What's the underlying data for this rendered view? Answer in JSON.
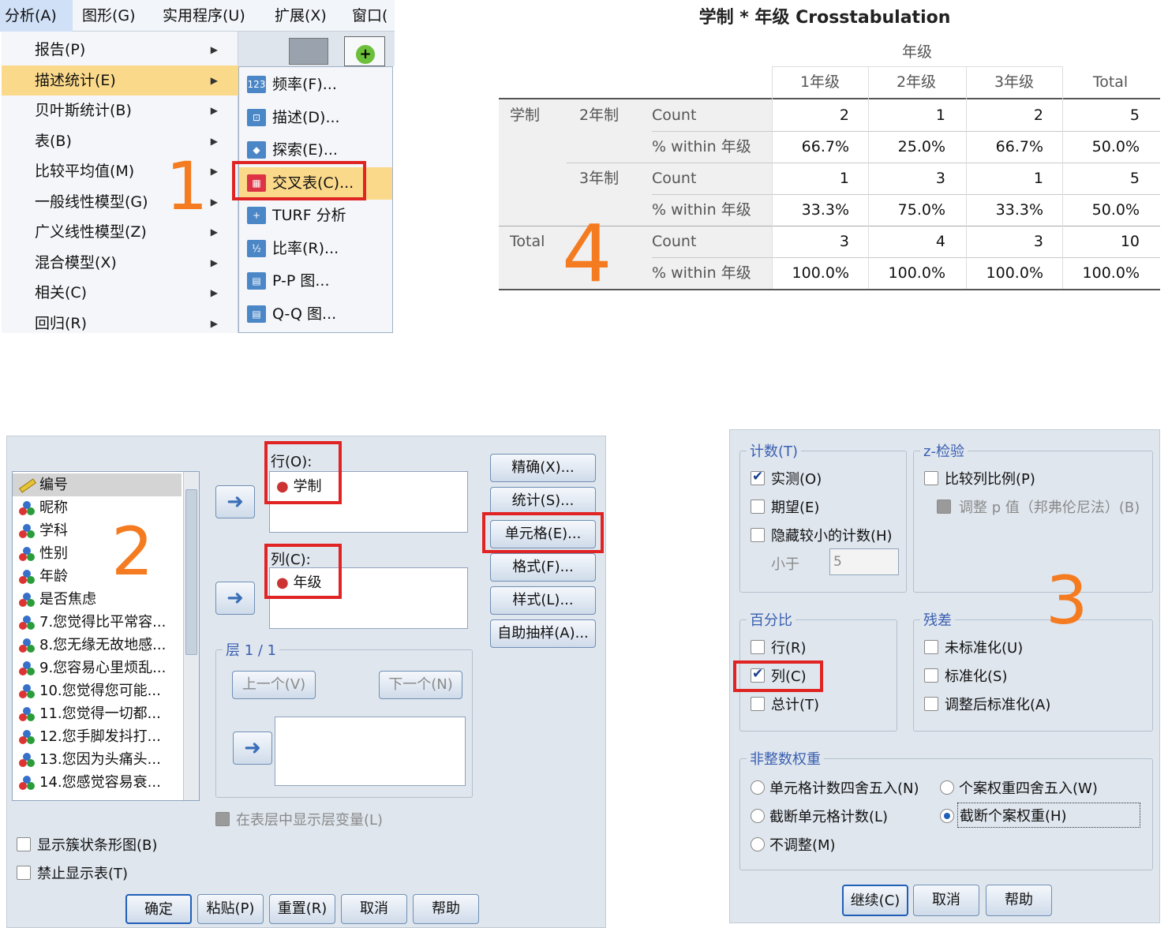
{
  "menubar": [
    "分析(A)",
    "图形(G)",
    "实用程序(U)",
    "扩展(X)",
    "窗口("
  ],
  "main_menu": [
    {
      "label": "报告(P)"
    },
    {
      "label": "描述统计(E)",
      "highlighted": true
    },
    {
      "label": "贝叶斯统计(B)"
    },
    {
      "label": "表(B)"
    },
    {
      "label": "比较平均值(M)"
    },
    {
      "label": "一般线性模型(G)"
    },
    {
      "label": "广义线性模型(Z)"
    },
    {
      "label": "混合模型(X)"
    },
    {
      "label": "相关(C)"
    },
    {
      "label": "回归(R)"
    }
  ],
  "sub_menu": [
    {
      "label": "频率(F)...",
      "icon": "frequency-icon",
      "glyph": "123"
    },
    {
      "label": "描述(D)...",
      "icon": "descriptives-icon",
      "glyph": "⊡"
    },
    {
      "label": "探索(E)...",
      "icon": "explore-icon",
      "glyph": "◆"
    },
    {
      "label": "交叉表(C)...",
      "icon": "crosstabs-icon",
      "glyph": "▦",
      "highlighted": true
    },
    {
      "label": "TURF 分析",
      "icon": "turf-icon",
      "glyph": "+"
    },
    {
      "label": "比率(R)...",
      "icon": "ratio-icon",
      "glyph": "½"
    },
    {
      "label": "P-P 图...",
      "icon": "pp-plot-icon",
      "glyph": "▤"
    },
    {
      "label": "Q-Q 图...",
      "icon": "qq-plot-icon",
      "glyph": "▤"
    }
  ],
  "step_numbers": {
    "s1": "1",
    "s2": "2",
    "s3": "3",
    "s4": "4"
  },
  "crosstab": {
    "title": "学制 * 年级 Crosstabulation",
    "col_group": "年级",
    "columns": [
      "1年级",
      "2年级",
      "3年级",
      "Total"
    ],
    "row_var": "学制",
    "rows": [
      {
        "group": "2年制",
        "stat": "Count",
        "values": [
          "2",
          "1",
          "2",
          "5"
        ]
      },
      {
        "group": "",
        "stat": "% within 年级",
        "values": [
          "66.7%",
          "25.0%",
          "66.7%",
          "50.0%"
        ]
      },
      {
        "group": "3年制",
        "stat": "Count",
        "values": [
          "1",
          "3",
          "1",
          "5"
        ]
      },
      {
        "group": "",
        "stat": "% within 年级",
        "values": [
          "33.3%",
          "75.0%",
          "33.3%",
          "50.0%"
        ]
      },
      {
        "group": "Total",
        "stat": "Count",
        "values": [
          "3",
          "4",
          "3",
          "10"
        ]
      },
      {
        "group": "",
        "stat": "% within 年级",
        "values": [
          "100.0%",
          "100.0%",
          "100.0%",
          "100.0%"
        ]
      }
    ]
  },
  "dialog": {
    "variables": [
      "编号",
      "昵称",
      "学科",
      "性别",
      "年龄",
      "是否焦虑",
      "7.您觉得比平常容...",
      "8.您无缘无故地感...",
      "9.您容易心里烦乱...",
      "10.您觉得您可能...",
      "11.您觉得一切都...",
      "12.您手脚发抖打...",
      "13.您因为头痛头...",
      "14.您感觉容易衰..."
    ],
    "row_label": "行(O):",
    "row_var": "学制",
    "col_label": "列(C):",
    "col_var": "年级",
    "layer_label": "层 1 / 1",
    "prev": "上一个(V)",
    "next": "下一个(N)",
    "show_layer": "在表层中显示层变量(L)",
    "side_buttons": [
      "精确(X)...",
      "统计(S)...",
      "单元格(E)...",
      "格式(F)...",
      "样式(L)...",
      "自助抽样(A)..."
    ],
    "bar_chart": "显示簇状条形图(B)",
    "suppress": "禁止显示表(T)",
    "bottom_buttons": [
      "确定",
      "粘贴(P)",
      "重置(R)",
      "取消",
      "帮助"
    ]
  },
  "cells": {
    "counts_title": "计数(T)",
    "observed": "实测(O)",
    "expected": "期望(E)",
    "hide_small": "隐藏较小的计数(H)",
    "less_than": "小于",
    "less_than_value": "5",
    "z_title": "z-检验",
    "compare_col": "比较列比例(P)",
    "adjust_p": "调整 p 值（邦弗伦尼法）(B)",
    "pct_title": "百分比",
    "pct_row": "行(R)",
    "pct_col": "列(C)",
    "pct_total": "总计(T)",
    "res_title": "残差",
    "res_unstd": "未标准化(U)",
    "res_std": "标准化(S)",
    "res_adj": "调整后标准化(A)",
    "weight_title": "非整数权重",
    "w1": "单元格计数四舍五入(N)",
    "w2": "个案权重四舍五入(W)",
    "w3": "截断单元格计数(L)",
    "w4": "截断个案权重(H)",
    "w5": "不调整(M)",
    "buttons": [
      "继续(C)",
      "取消",
      "帮助"
    ]
  }
}
